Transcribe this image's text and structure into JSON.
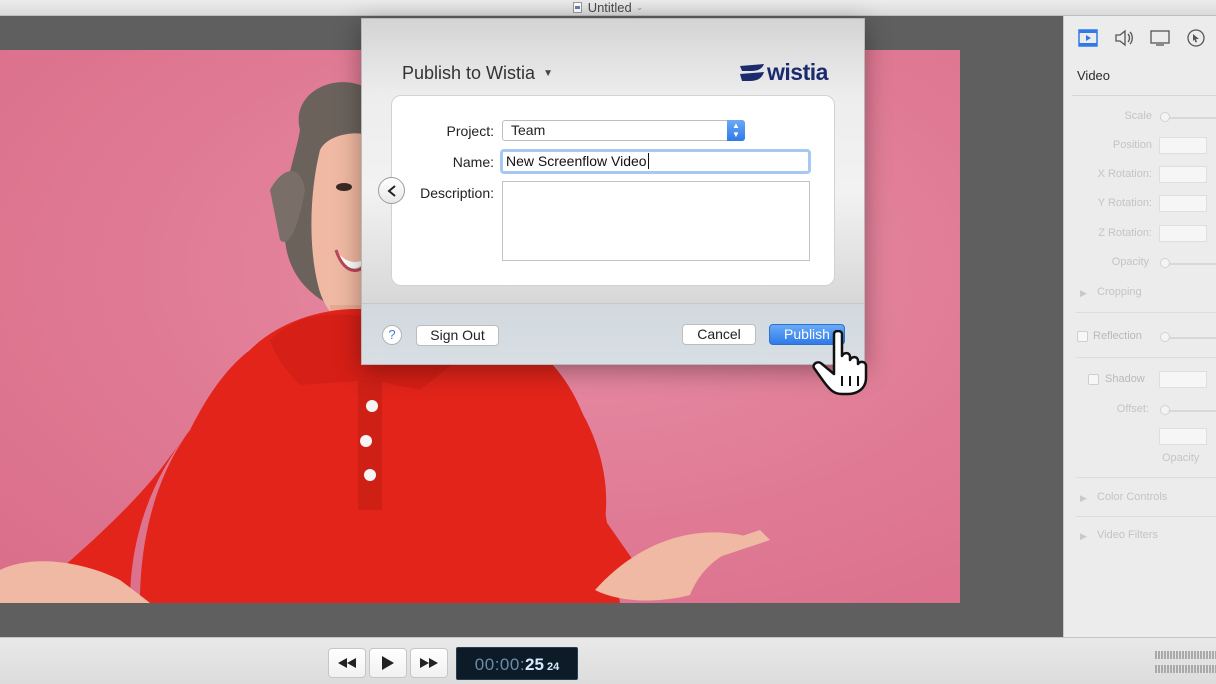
{
  "window": {
    "title": "Untitled"
  },
  "dialog": {
    "title": "Publish to Wistia",
    "brand": "wistia",
    "fields": {
      "project_label": "Project:",
      "project_value": "Team",
      "name_label": "Name:",
      "name_value": "New Screenflow Video",
      "description_label": "Description:",
      "description_value": ""
    },
    "buttons": {
      "help": "?",
      "sign_out": "Sign Out",
      "cancel": "Cancel",
      "publish": "Publish"
    }
  },
  "inspector": {
    "section_title": "Video",
    "tabs": [
      "video-icon",
      "audio-icon",
      "screen-icon",
      "callout-icon"
    ],
    "labels": {
      "scale": "Scale",
      "position": "Position",
      "x_rotation": "X Rotation:",
      "y_rotation": "Y Rotation:",
      "z_rotation": "Z Rotation:",
      "opacity": "Opacity",
      "cropping": "Cropping",
      "reflection": "Reflection",
      "shadow": "Shadow",
      "offset": "Offset:",
      "shadow_opacity": "Opacity",
      "color_controls": "Color Controls",
      "video_filters": "Video Filters"
    }
  },
  "transport": {
    "timecode_dim": "00:00:",
    "timecode_bright": "25",
    "timecode_frames": "24"
  },
  "colors": {
    "accent": "#2f7ae8",
    "wistia_navy": "#1c2a6e",
    "backdrop_pink": "#e07a94",
    "sweater_red": "#e2241a"
  }
}
